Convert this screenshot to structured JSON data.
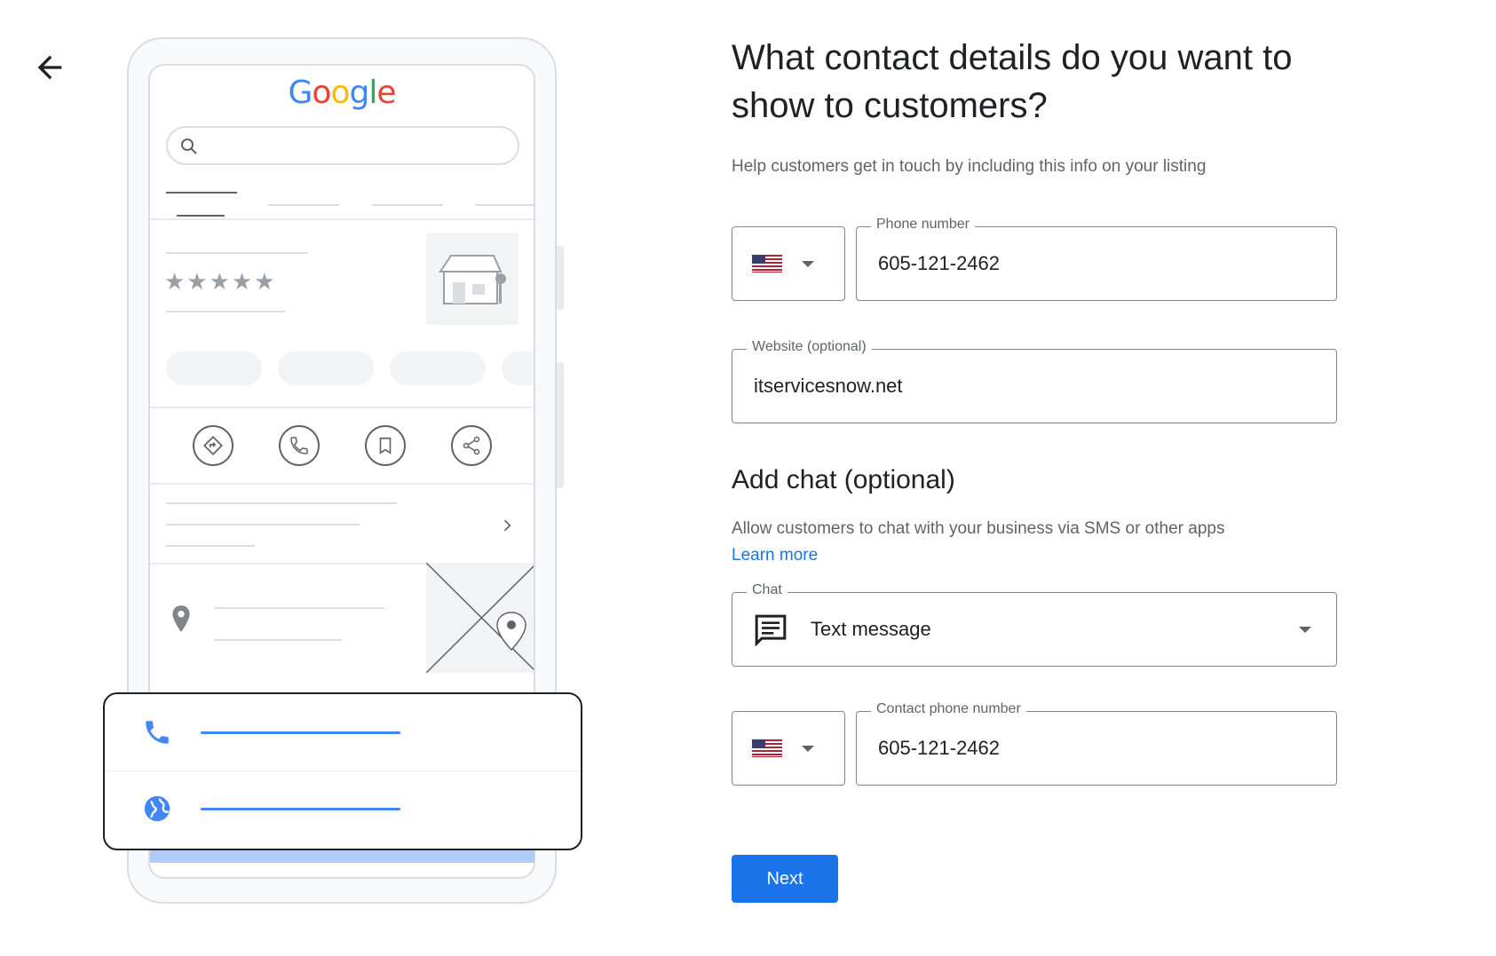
{
  "title": "What contact details do you want to show to customers?",
  "subtitle": "Help customers get in touch by including this info on your listing",
  "phone": {
    "label": "Phone number",
    "value": "605-121-2462",
    "country_flag": "us-flag-icon"
  },
  "website": {
    "label": "Website (optional)",
    "value": "itservicesnow.net"
  },
  "chat_section": {
    "title": "Add chat (optional)",
    "description": "Allow customers to chat with your business via SMS or other apps",
    "learn_more": "Learn more"
  },
  "chat": {
    "label": "Chat",
    "value": "Text message",
    "icon": "message-icon"
  },
  "contact_phone": {
    "label": "Contact phone number",
    "value": "605-121-2462",
    "country_flag": "us-flag-icon"
  },
  "next_label": "Next",
  "illustration": {
    "logo_text": "Google",
    "rating_stars": 5
  },
  "colors": {
    "primary": "#1a73e8",
    "google_blue": "#4285f4",
    "google_red": "#ea4335",
    "google_yellow": "#fbbc05",
    "google_green": "#34a853"
  }
}
